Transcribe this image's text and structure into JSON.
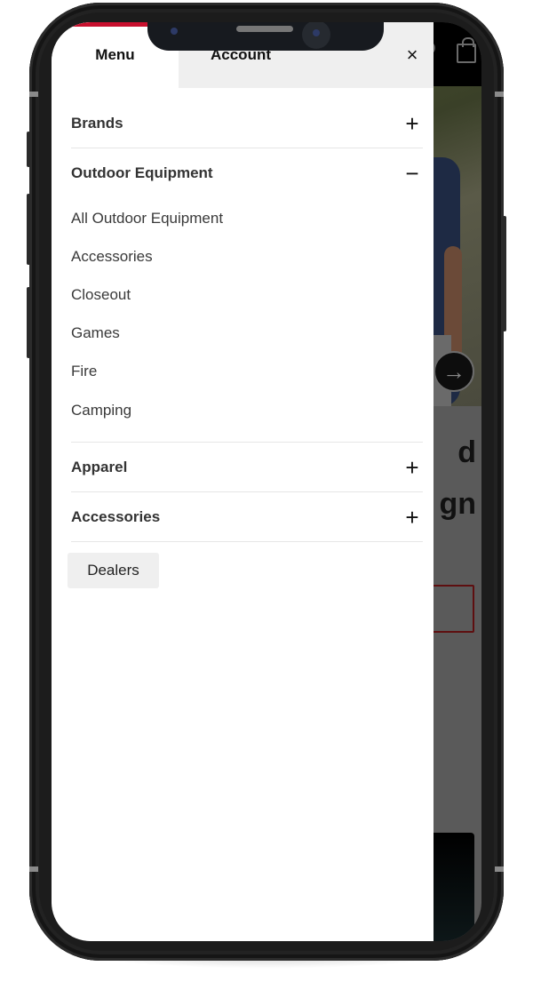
{
  "menu": {
    "tabs": [
      {
        "label": "Menu",
        "active": true
      },
      {
        "label": "Account",
        "active": false
      }
    ],
    "close_icon": "×",
    "sections": [
      {
        "title": "Brands",
        "expanded": false,
        "toggle_icon": "+"
      },
      {
        "title": "Outdoor Equipment",
        "expanded": true,
        "toggle_icon": "−",
        "items": [
          "All Outdoor Equipment",
          "Accessories",
          "Closeout",
          "Games",
          "Fire",
          "Camping"
        ]
      },
      {
        "title": "Apparel",
        "expanded": false,
        "toggle_icon": "+"
      },
      {
        "title": "Accessories",
        "expanded": false,
        "toggle_icon": "+"
      }
    ],
    "dealers_label": "Dealers"
  },
  "background": {
    "headline_lines": [
      "d",
      "gn"
    ],
    "carousel_next_icon": "→"
  },
  "colors": {
    "brand_red": "#c8102e",
    "tab_inactive_bg": "#efefef",
    "dealers_bg": "#efefef"
  }
}
